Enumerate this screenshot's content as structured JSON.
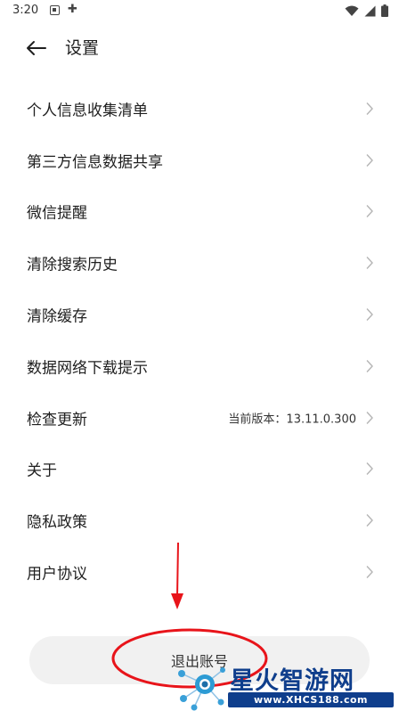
{
  "status_bar": {
    "time": "3:20",
    "icons": [
      "a-icon",
      "bug-icon",
      "wifi-icon",
      "signal-icon",
      "battery-icon"
    ]
  },
  "header": {
    "title": "设置",
    "back_icon": "arrow-left-icon"
  },
  "menu": [
    {
      "label": "个人信息收集清单"
    },
    {
      "label": "第三方信息数据共享"
    },
    {
      "label": "微信提醒"
    },
    {
      "label": "清除搜索历史"
    },
    {
      "label": "清除缓存"
    },
    {
      "label": "数据网络下载提示"
    },
    {
      "label": "检查更新",
      "value": "当前版本：13.11.0.300"
    },
    {
      "label": "关于"
    },
    {
      "label": "隐私政策"
    },
    {
      "label": "用户协议"
    }
  ],
  "logout": {
    "label": "退出账号"
  },
  "annotations": {
    "color": "#e8141a"
  },
  "watermark": {
    "title": "星火智游网",
    "url": "www.XHCS188.com",
    "color": "#0f3e8c"
  }
}
